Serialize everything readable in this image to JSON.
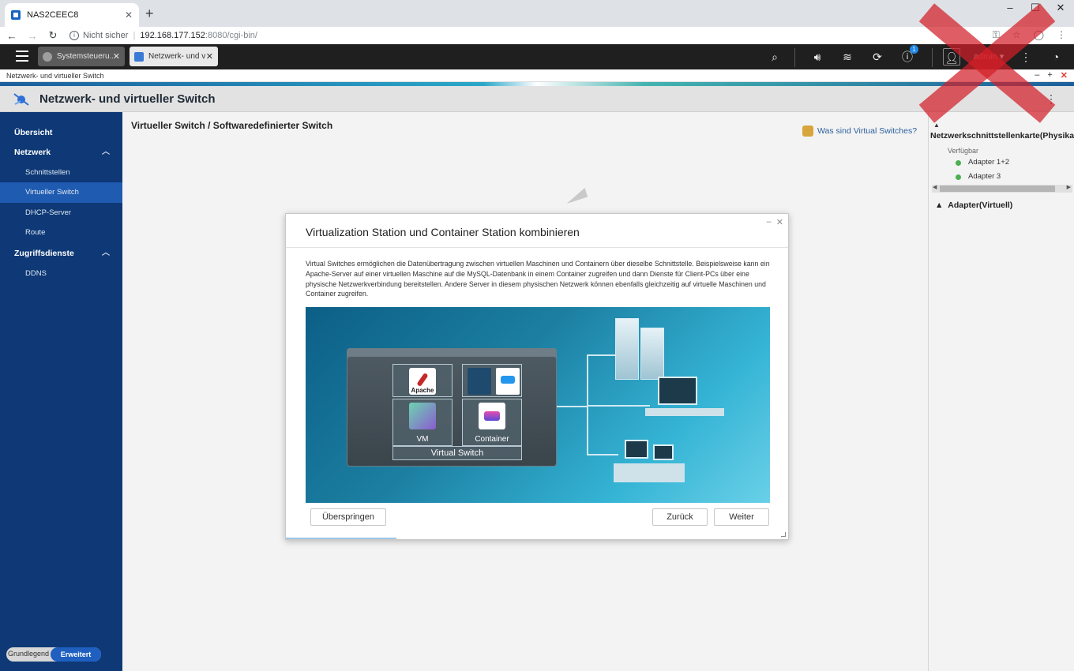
{
  "browser": {
    "tab_title": "NAS2CEEC8",
    "address_label": "Nicht sicher",
    "address_host": "192.168.177.152",
    "address_path": ":8080/cgi-bin/",
    "window_min": "–",
    "window_max": "☐",
    "window_close": "✕"
  },
  "qts_bar": {
    "tabs": [
      {
        "label": "Systemsteueru..."
      },
      {
        "label": "Netzwerk- und v..."
      }
    ],
    "notification_count": "1",
    "user": "admin ▾"
  },
  "window": {
    "title_strip": "Netzwerk- und virtueller Switch",
    "app_title": "Netzwerk- und virtueller Switch"
  },
  "sidebar": {
    "items": [
      {
        "label": "Übersicht"
      },
      {
        "label": "Netzwerk"
      },
      {
        "label": "Schnittstellen"
      },
      {
        "label": "Virtueller Switch"
      },
      {
        "label": "DHCP-Server"
      },
      {
        "label": "Route"
      },
      {
        "label": "Zugriffsdienste"
      },
      {
        "label": "DDNS"
      }
    ],
    "mode_basic": "Grundlegend",
    "mode_advanced": "Erweitert"
  },
  "main": {
    "breadcrumb": "Virtueller Switch / Softwaredefinierter Switch",
    "help_link": "Was sind Virtual Switches?"
  },
  "right_panel": {
    "nic_title": "Netzwerkschnittstellenkarte(Physikalisch)",
    "available": "Verfügbar",
    "adapters": [
      "Adapter 1+2",
      "Adapter 3"
    ],
    "virtual_title": "Adapter(Virtuell)"
  },
  "dialog": {
    "title": "Virtualization Station und Container Station kombinieren",
    "description": "Virtual Switches ermöglichen die Datenübertragung zwischen virtuellen Maschinen und Containern über dieselbe Schnittstelle. Beispielsweise kann ein Apache-Server auf einer virtuellen Maschine auf die MySQL-Datenbank in einem Container zugreifen und dann Dienste für Client-PCs über eine physische Netzwerkverbindung bereitstellen. Andere Server in diesem physischen Netzwerk können ebenfalls gleichzeitig auf virtuelle Maschinen und Container zugreifen.",
    "illustration": {
      "apache_label": "Apache",
      "vm_label": "VM",
      "container_label": "Container",
      "virtual_switch_label": "Virtual Switch"
    },
    "skip_label": "Überspringen",
    "back_label": "Zurück",
    "next_label": "Weiter"
  },
  "colors": {
    "sidebar_bg": "#0e3976",
    "sidebar_active": "#1e5bb1",
    "accent": "#1f5fbf",
    "status_ok": "#4caf50"
  }
}
